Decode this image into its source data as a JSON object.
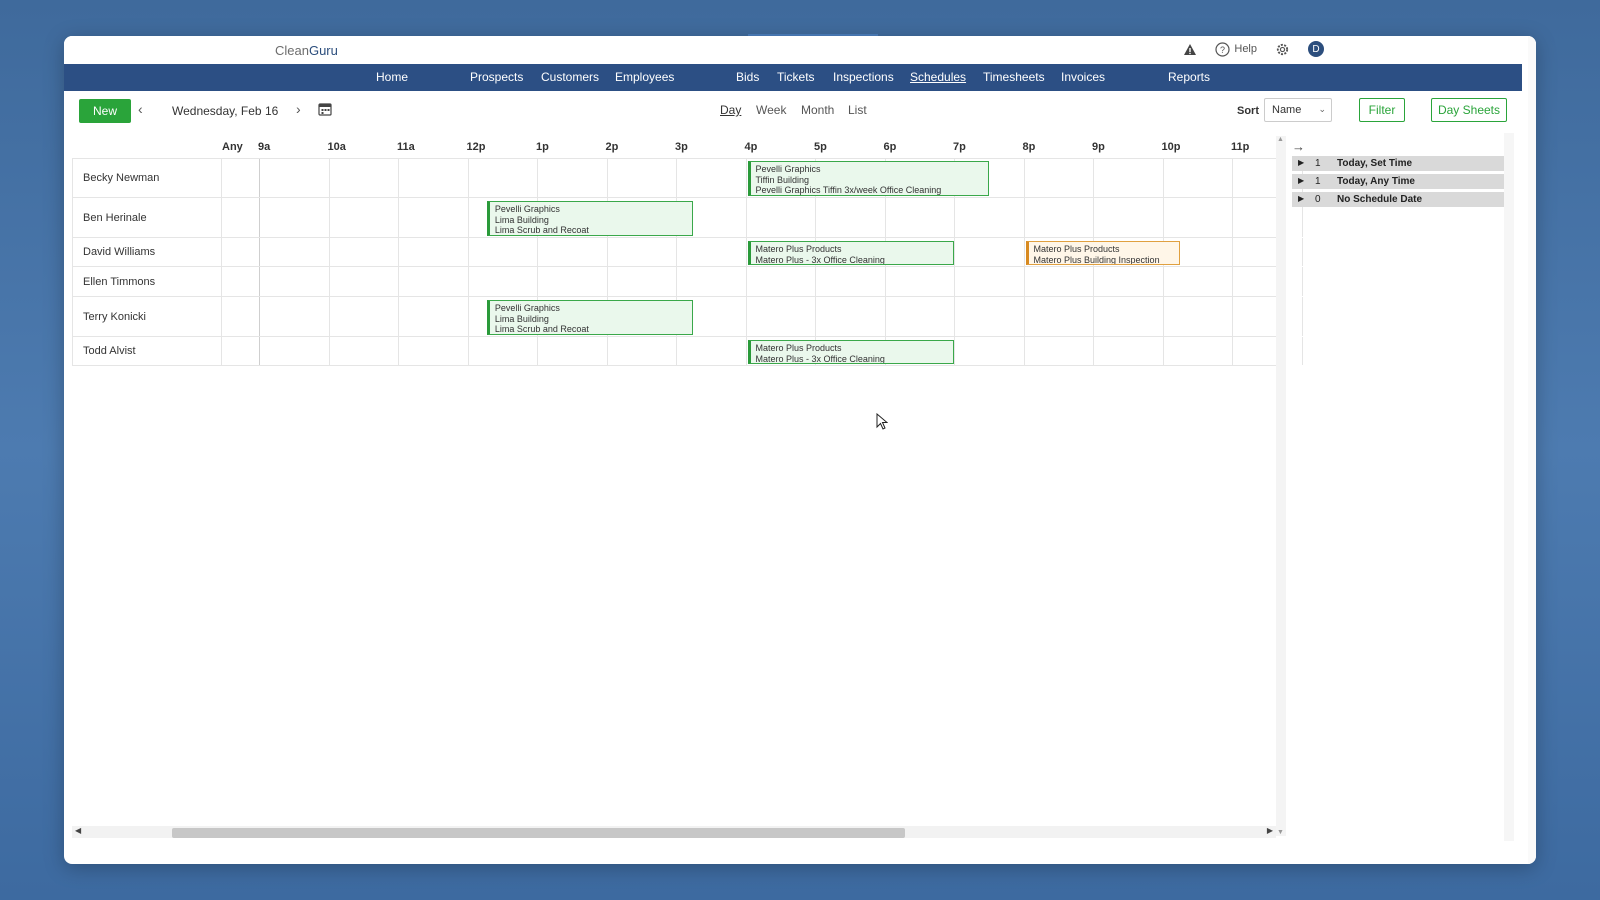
{
  "app": {
    "logo_part1": "Clean",
    "logo_part2": "Guru",
    "help_label": "Help",
    "user_initial": "D"
  },
  "nav": [
    {
      "label": "Home",
      "active": false
    },
    {
      "label": "Prospects",
      "active": false
    },
    {
      "label": "Customers",
      "active": false
    },
    {
      "label": "Employees",
      "active": false
    },
    {
      "label": "Bids",
      "active": false
    },
    {
      "label": "Tickets",
      "active": false
    },
    {
      "label": "Inspections",
      "active": false
    },
    {
      "label": "Schedules",
      "active": true
    },
    {
      "label": "Timesheets",
      "active": false
    },
    {
      "label": "Invoices",
      "active": false
    },
    {
      "label": "Reports",
      "active": false
    }
  ],
  "toolbar": {
    "new_label": "New",
    "date": "Wednesday, Feb 16",
    "views": [
      "Day",
      "Week",
      "Month",
      "List"
    ],
    "active_view": "Day",
    "sort_label": "Sort",
    "sort_value": "Name",
    "filter_label": "Filter",
    "day_sheets_label": "Day Sheets"
  },
  "hours": [
    "Any",
    "9a",
    "10a",
    "11a",
    "12p",
    "1p",
    "2p",
    "3p",
    "4p",
    "5p",
    "6p",
    "7p",
    "8p",
    "9p",
    "10p",
    "11p"
  ],
  "employees": [
    {
      "name": "Becky Newman"
    },
    {
      "name": "Ben Herinale"
    },
    {
      "name": "David Williams"
    },
    {
      "name": "Ellen Timmons"
    },
    {
      "name": "Terry Konicki"
    },
    {
      "name": "Todd Alvist"
    }
  ],
  "events": [
    {
      "employee": "Becky Newman",
      "start": "4p",
      "end": "7:30p",
      "status": "green",
      "lines": [
        "Pevelli Graphics",
        "Tiffin Building",
        "Pevelli Graphics Tiffin 3x/week Office Cleaning"
      ]
    },
    {
      "employee": "Ben Herinale",
      "start": "12:15p",
      "end": "3:15p",
      "status": "green",
      "lines": [
        "Pevelli Graphics",
        "Lima Building",
        "Lima Scrub and Recoat"
      ]
    },
    {
      "employee": "David Williams",
      "start": "4p",
      "end": "7p",
      "status": "green",
      "lines": [
        "Matero Plus Products",
        "Matero Plus - 3x Office Cleaning"
      ]
    },
    {
      "employee": "David Williams",
      "start": "8p",
      "end": "10:15p",
      "status": "orange",
      "lines": [
        "Matero Plus Products",
        "Matero Plus Building Inspection"
      ]
    },
    {
      "employee": "Terry Konicki",
      "start": "12:15p",
      "end": "3:15p",
      "status": "green",
      "lines": [
        "Pevelli Graphics",
        "Lima Building",
        "Lima Scrub and Recoat"
      ]
    },
    {
      "employee": "Todd Alvist",
      "start": "4p",
      "end": "7p",
      "status": "green",
      "lines": [
        "Matero Plus Products",
        "Matero Plus - 3x Office Cleaning"
      ]
    }
  ],
  "side_panel": [
    {
      "count": "1",
      "label": "Today, Set Time"
    },
    {
      "count": "1",
      "label": "Today, Any Time"
    },
    {
      "count": "0",
      "label": "No Schedule Date"
    }
  ],
  "colors": {
    "nav_bg": "#2c4f84",
    "accent_green": "#2aa43a",
    "event_orange": "#d88a20"
  }
}
